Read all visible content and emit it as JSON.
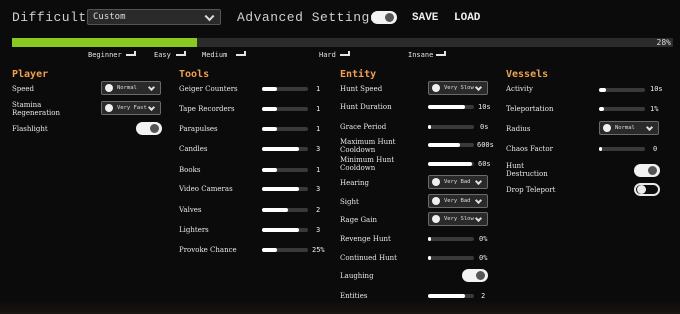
{
  "header": {
    "difficulty_label": "Difficulty",
    "difficulty_value": "Custom",
    "advanced_settings_label": "Advanced Settings",
    "advanced_settings_on": true,
    "save_label": "SAVE",
    "load_label": "LOAD"
  },
  "progress": {
    "value_percent": 28,
    "label": "28%",
    "markers": [
      "Beginner",
      "Easy",
      "Medium",
      "Hard",
      "Insane"
    ]
  },
  "player": {
    "title": "Player",
    "speed_label": "Speed",
    "speed_value": "Normal",
    "stamina_label_1": "Stamina",
    "stamina_label_2": "Regeneration",
    "stamina_value": "Very Fast",
    "flashlight_label": "Flashlight",
    "flashlight_on": true
  },
  "tools": {
    "title": "Tools",
    "items": [
      {
        "label": "Geiger Counters",
        "value": "1",
        "fill": 0.33
      },
      {
        "label": "Tape Recorders",
        "value": "1",
        "fill": 0.33
      },
      {
        "label": "Parapulses",
        "value": "1",
        "fill": 0.33
      },
      {
        "label": "Candles",
        "value": "3",
        "fill": 0.8
      },
      {
        "label": "Books",
        "value": "1",
        "fill": 0.33
      },
      {
        "label": "Video Cameras",
        "value": "3",
        "fill": 0.8
      },
      {
        "label": "Valves",
        "value": "2",
        "fill": 0.57
      },
      {
        "label": "Lighters",
        "value": "3",
        "fill": 0.8
      },
      {
        "label": "Provoke Chance",
        "value": "25%",
        "fill": 0.33
      }
    ]
  },
  "entity": {
    "title": "Entity",
    "hunt_speed_label": "Hunt Speed",
    "hunt_speed_value": "Very Slow",
    "hunt_duration_label": "Hunt Duration",
    "hunt_duration_value": "10s",
    "hunt_duration_fill": 0.8,
    "grace_label": "Grace Period",
    "grace_value": "0s",
    "grace_fill": 0.06,
    "max_cd_label_1": "Maximum Hunt",
    "max_cd_label_2": "Cooldown",
    "max_cd_value": "600s",
    "max_cd_fill": 0.7,
    "min_cd_label_1": "Minimum Hunt",
    "min_cd_label_2": "Cooldown",
    "min_cd_value": "60s",
    "min_cd_fill": 0.95,
    "hearing_label": "Hearing",
    "hearing_value": "Very Bad",
    "sight_label": "Sight",
    "sight_value": "Very Bad",
    "rage_label": "Rage Gain",
    "rage_value": "Very Slow",
    "revenge_label": "Revenge Hunt",
    "revenge_value": "0%",
    "revenge_fill": 0.06,
    "continued_label": "Continued Hunt",
    "continued_value": "0%",
    "continued_fill": 0.06,
    "laughing_label": "Laughing",
    "laughing_on": true,
    "entities_label": "Entities",
    "entities_value": "2",
    "entities_fill": 0.8
  },
  "vessels": {
    "title": "Vessels",
    "activity_label": "Activity",
    "activity_value": "10s",
    "activity_fill": 0.15,
    "teleportation_label": "Teleportation",
    "teleportation_value": "1%",
    "teleportation_fill": 0.1,
    "radius_label": "Radius",
    "radius_value": "Normal",
    "chaos_label": "Chaos Factor",
    "chaos_value": "0",
    "chaos_fill": 0.06,
    "hunt_destruction_label_1": "Hunt",
    "hunt_destruction_label_2": "Destruction",
    "hunt_destruction_on": true,
    "drop_teleport_label": "Drop Teleport",
    "drop_teleport_on": false
  }
}
